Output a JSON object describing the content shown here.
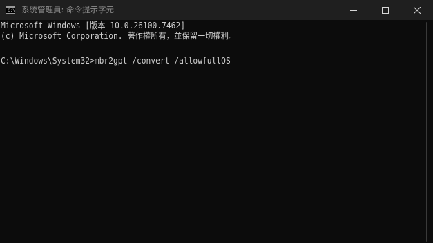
{
  "window": {
    "title": "系統管理員: 命令提示字元",
    "icon": "cmd-icon",
    "icon_glyph": "C:\\"
  },
  "controls": {
    "minimize_icon": "minimize-icon",
    "maximize_icon": "maximize-icon",
    "close_icon": "close-icon"
  },
  "console": {
    "lines": [
      "Microsoft Windows [版本 10.0.26100.7462]",
      "(c) Microsoft Corporation. 著作權所有，並保留一切權利。",
      "C:\\Windows\\System32>mbr2gpt /convert /allowfullOS"
    ]
  },
  "colors": {
    "background": "#0c0c0c",
    "titlebar": "#1f1f1f",
    "text": "#cccccc",
    "title_text": "#8c8c8c"
  }
}
